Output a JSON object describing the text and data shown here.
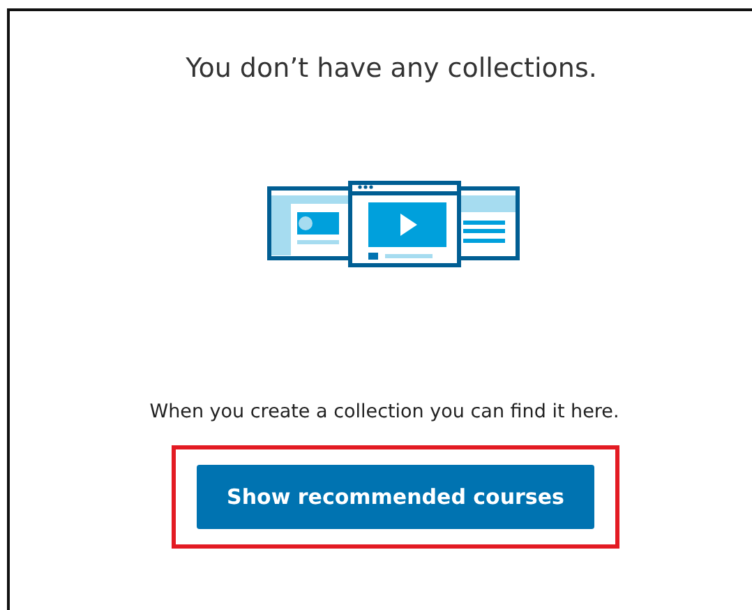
{
  "empty_state": {
    "title": "You don’t have any collections.",
    "message": "When you create a collection you can find it here.",
    "button": {
      "label": "Show recommended courses",
      "highlighted": true
    }
  }
}
